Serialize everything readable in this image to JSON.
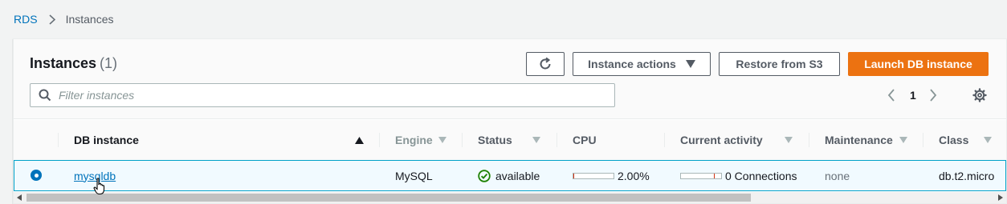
{
  "breadcrumb": {
    "root": "RDS",
    "separator_icon": "chevron-right-icon",
    "current": "Instances"
  },
  "header": {
    "title": "Instances",
    "count": "(1)"
  },
  "toolbar": {
    "refresh_icon": "refresh-icon",
    "actions_label": "Instance actions",
    "restore_label": "Restore from S3",
    "launch_label": "Launch DB instance"
  },
  "search": {
    "placeholder": "Filter instances",
    "value": ""
  },
  "pagination": {
    "current_page": "1"
  },
  "table": {
    "columns": [
      "DB instance",
      "Engine",
      "Status",
      "CPU",
      "Current activity",
      "Maintenance",
      "Class"
    ],
    "sorted_column": "DB instance",
    "sort_direction": "ascending",
    "rows": [
      {
        "selected": true,
        "db_instance": "mysqldb",
        "engine": "MySQL",
        "status": "available",
        "cpu": "2.00%",
        "cpu_fraction": 0.02,
        "current_activity": "0 Connections",
        "maintenance": "none",
        "class": "db.t2.micro"
      }
    ]
  },
  "colors": {
    "link": "#0073bb",
    "primary_button": "#ec7211",
    "status_ok": "#1d8102",
    "selected_row_border": "#00a1c9",
    "selected_row_bg": "#f1faff"
  }
}
